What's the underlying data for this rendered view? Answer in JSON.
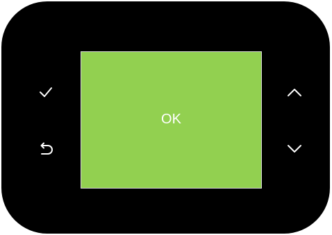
{
  "screen": {
    "status_text": "OK",
    "background_color": "#92d050"
  },
  "device": {
    "body_color": "#000000",
    "icon_color": "#ffffff"
  },
  "buttons": {
    "left": [
      {
        "icon": "checkmark-icon",
        "name": "confirm-button"
      },
      {
        "icon": "return-arrow-icon",
        "name": "back-button"
      }
    ],
    "right": [
      {
        "icon": "chevron-up-icon",
        "name": "up-button"
      },
      {
        "icon": "chevron-down-icon",
        "name": "down-button"
      }
    ]
  }
}
